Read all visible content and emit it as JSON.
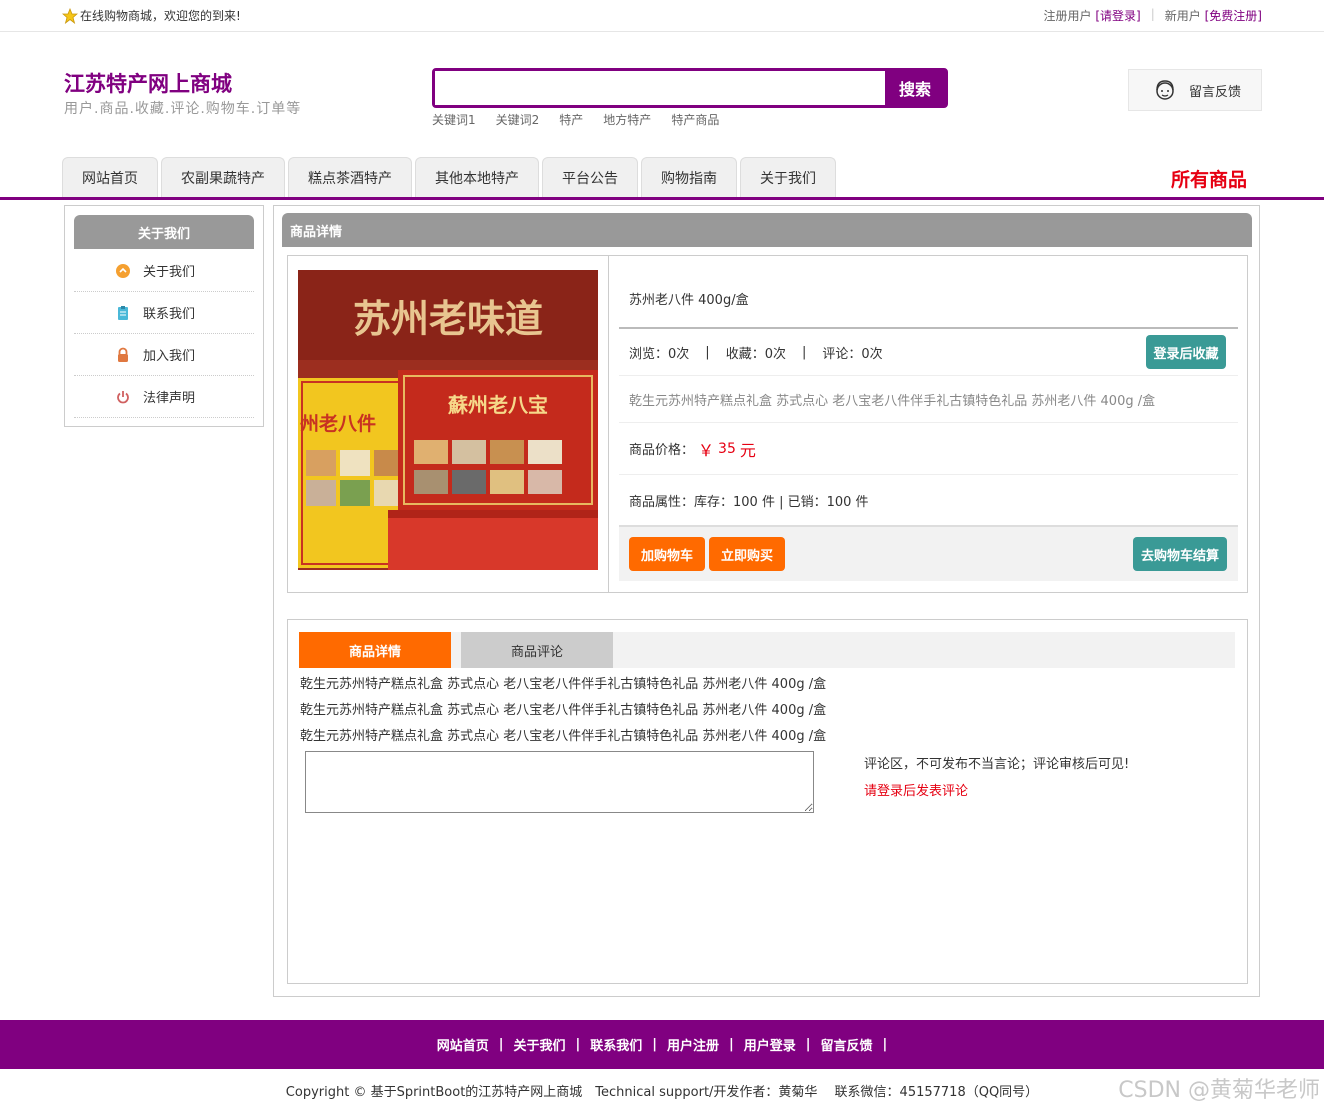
{
  "topbar": {
    "welcome": "在线购物商城，欢迎您的到来!",
    "register_user_label": "注册用户",
    "login_link": "[请登录]",
    "new_user_label": "新用户",
    "signup_link": "[免费注册]"
  },
  "header": {
    "site_title": "江苏特产网上商城",
    "site_subtitle": "用户.商品.收藏.评论.购物车.订单等",
    "search_button": "搜索",
    "search_value": "",
    "keywords": [
      "关键词1",
      "关键词2",
      "特产",
      "地方特产",
      "特产商品"
    ],
    "feedback_label": "留言反馈"
  },
  "nav": {
    "tabs": [
      "网站首页",
      "农副果蔬特产",
      "糕点茶酒特产",
      "其他本地特产",
      "平台公告",
      "购物指南",
      "关于我们"
    ],
    "all_goods": "所有商品"
  },
  "sidebar": {
    "title": "关于我们",
    "items": [
      {
        "label": "关于我们",
        "icon": "info-icon",
        "color": "#f5a030"
      },
      {
        "label": "联系我们",
        "icon": "clipboard-icon",
        "color": "#4ab8d8"
      },
      {
        "label": "加入我们",
        "icon": "lock-icon",
        "color": "#e07840"
      },
      {
        "label": "法律声明",
        "icon": "power-icon",
        "color": "#d06060"
      }
    ]
  },
  "product": {
    "panel_title": "商品详情",
    "image_text_main": "苏州老味道",
    "image_text_box1": "蘇州老八宝",
    "image_text_box2": "州老八件",
    "name": "苏州老八件 400g/盒",
    "views_label": "浏览：",
    "views": "0次",
    "favorites_label": "收藏：",
    "favorites": "0次",
    "comments_label": "评论：",
    "comments": "0次",
    "favorite_button": "登录后收藏",
    "description": "乾生元苏州特产糕点礼盒 苏式点心 老八宝老八件伴手礼古镇特色礼品 苏州老八件 400g /盒",
    "price_label": "商品价格：",
    "price_symbol": "￥",
    "price": "35",
    "price_unit": "元",
    "attr_label": "商品属性：",
    "stock_text": "库存：100 件 | 已销：100 件",
    "add_cart_button": "加购物车",
    "buy_now_button": "立即购买",
    "checkout_button": "去购物车结算"
  },
  "detail": {
    "tab_detail": "商品详情",
    "tab_reviews": "商品评论",
    "lines": [
      "乾生元苏州特产糕点礼盒 苏式点心 老八宝老八件伴手礼古镇特色礼品 苏州老八件 400g /盒",
      "乾生元苏州特产糕点礼盒 苏式点心 老八宝老八件伴手礼古镇特色礼品 苏州老八件 400g /盒",
      "乾生元苏州特产糕点礼盒 苏式点心 老八宝老八件伴手礼古镇特色礼品 苏州老八件 400g /盒"
    ],
    "comment_value": "",
    "comment_note": "评论区，不可发布不当言论；评论审核后可见!",
    "comment_login": "请登录后发表评论"
  },
  "footer": {
    "links": [
      "网站首页",
      "关于我们",
      "联系我们",
      "用户注册",
      "用户登录",
      "留言反馈"
    ],
    "separator": "|",
    "copyright": "Copyright © 基于SprintBoot的江苏特产网上商城　Technical support/开发作者：黄菊华　 联系微信：45157718（QQ同号）",
    "watermark": "CSDN @黄菊华老师"
  },
  "colors": {
    "brand": "#800080",
    "accent_orange": "#ff6a00",
    "teal": "#3a9a96",
    "price_red": "#e60012"
  }
}
